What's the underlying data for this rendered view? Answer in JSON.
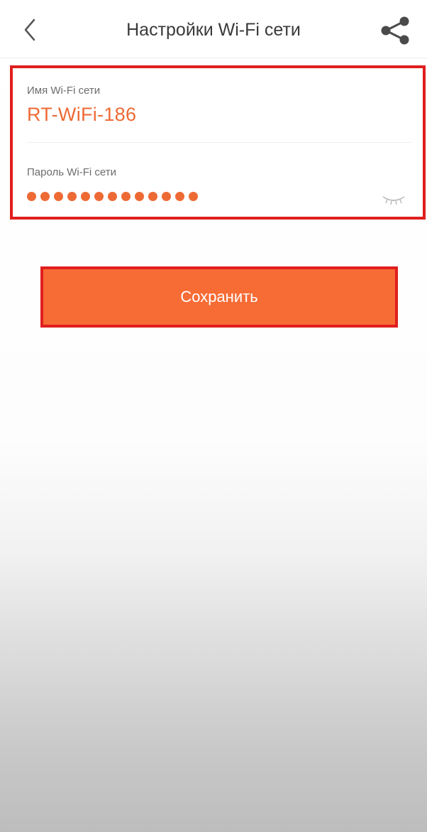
{
  "header": {
    "title": "Настройки Wi-Fi сети",
    "back_icon": "chevron-left-icon",
    "share_icon": "share-icon"
  },
  "form": {
    "ssid_label": "Имя Wi-Fi сети",
    "ssid_value": "RT-WiFi-186",
    "password_label": "Пароль Wi-Fi сети",
    "password_mask_count": 13,
    "visibility_icon": "eye-closed-icon"
  },
  "actions": {
    "save_label": "Сохранить"
  },
  "colors": {
    "accent": "#ee6a35",
    "button": "#f76b35",
    "highlight": "#e01e1e"
  }
}
